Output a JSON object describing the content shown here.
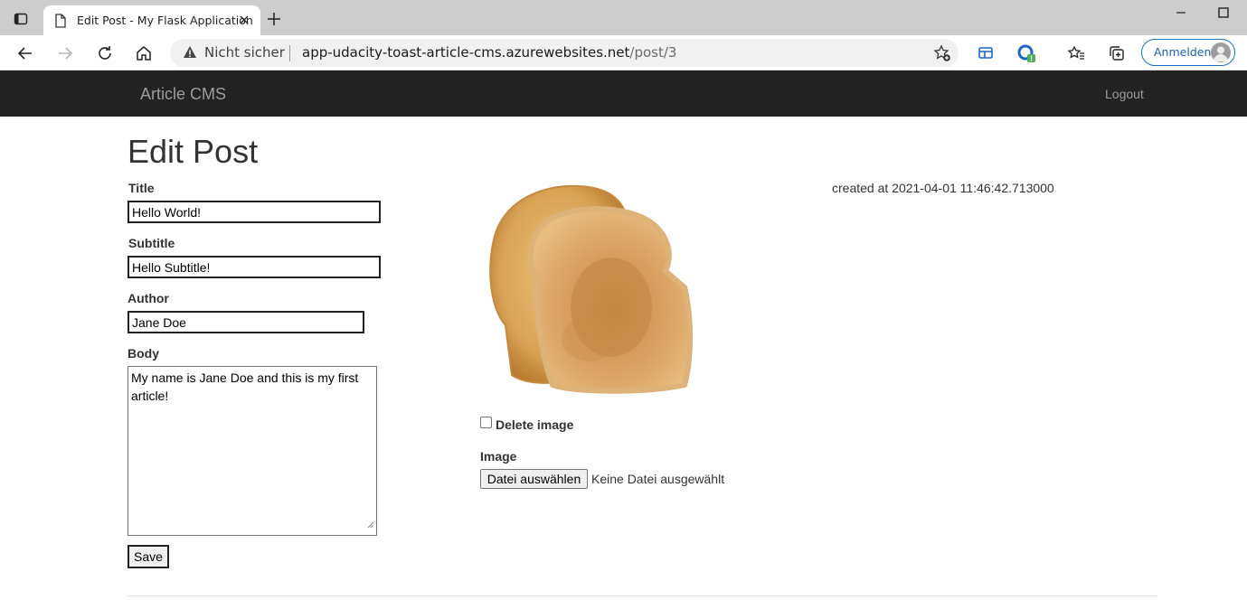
{
  "browser": {
    "tab_title": "Edit Post - My Flask Application",
    "security_label": "Nicht sicher",
    "url_host": "app-udacity-toast-article-cms.azurewebsites.net",
    "url_path": "/post/3",
    "signin_label": "Anmelden"
  },
  "navbar": {
    "brand": "Article CMS",
    "logout_label": "Logout"
  },
  "page": {
    "title": "Edit Post",
    "created_at": "created at 2021-04-01 11:46:42.713000"
  },
  "form": {
    "title_label": "Title",
    "title_value": "Hello World!",
    "subtitle_label": "Subtitle",
    "subtitle_value": "Hello Subtitle!",
    "author_label": "Author",
    "author_value": "Jane Doe",
    "body_label": "Body",
    "body_value": "My name is Jane Doe and this is my first article!",
    "save_label": "Save",
    "delete_image_label": "Delete image",
    "delete_image_checked": false,
    "image_label": "Image",
    "file_button_label": "Datei auswählen",
    "file_status": "Keine Datei ausgewählt"
  },
  "icons": {
    "tab_actions": "tab-actions-icon",
    "page": "page-icon",
    "close": "close-icon",
    "new_tab": "plus-icon",
    "back": "back-arrow-icon",
    "forward": "forward-arrow-icon",
    "reload": "reload-icon",
    "home": "home-icon",
    "warning": "warning-icon",
    "add_favorite": "star-plus-icon",
    "collections": "collections-icon",
    "extension": "extension-icon",
    "favorites": "favorites-icon",
    "profile": "avatar"
  },
  "colors": {
    "navbar_bg": "#222222",
    "navbar_text": "#9d9d9d",
    "accent": "#1a73c8"
  }
}
